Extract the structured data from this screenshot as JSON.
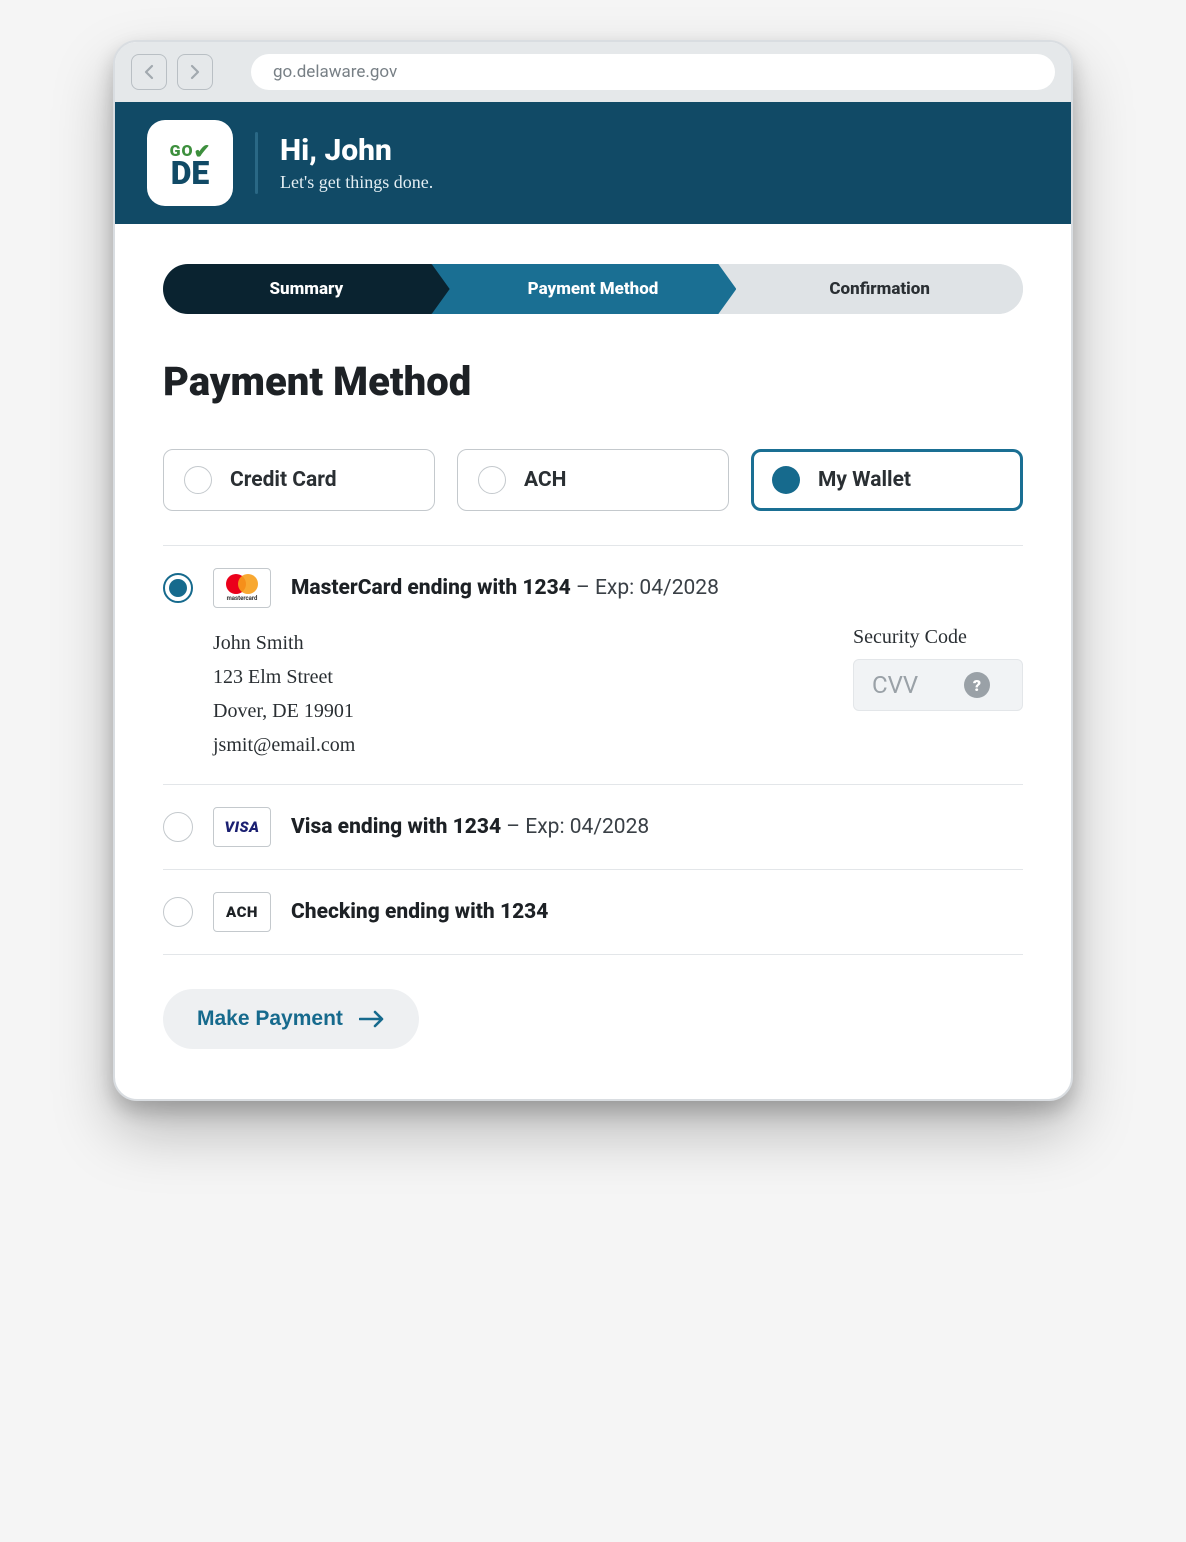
{
  "browser": {
    "url": "go.delaware.gov"
  },
  "header": {
    "logo_top": "GO",
    "logo_bottom": "DE",
    "greeting": "Hi, John",
    "subtitle": "Let's get things done."
  },
  "progress": {
    "step1": "Summary",
    "step2": "Payment Method",
    "step3": "Confirmation"
  },
  "page_title": "Payment Method",
  "types": {
    "credit": "Credit Card",
    "ach": "ACH",
    "wallet": "My Wallet"
  },
  "wallet": [
    {
      "brand": "mastercard",
      "title_strong": "MasterCard ending with 1234",
      "title_rest": " – Exp: 04/2028",
      "selected": true,
      "billing": {
        "name": "John Smith",
        "street": "123 Elm Street",
        "city": "Dover, DE 19901",
        "email": "jsmit@email.com"
      }
    },
    {
      "brand": "visa",
      "title_strong": "Visa ending with 1234",
      "title_rest": " – Exp: 04/2028",
      "selected": false
    },
    {
      "brand": "ach",
      "title_strong": "Checking ending with 1234",
      "title_rest": "",
      "selected": false
    }
  ],
  "cvv": {
    "label": "Security Code",
    "placeholder": "CVV"
  },
  "cta": "Make Payment"
}
